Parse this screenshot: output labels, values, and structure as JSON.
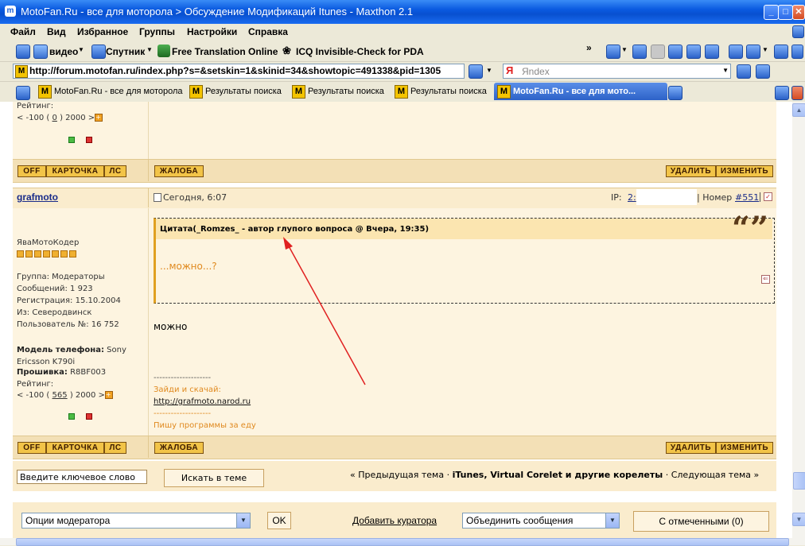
{
  "window": {
    "title": "MotoFan.Ru - все для моторола > Обсуждение Модификаций Itunes - Maxthon 2.1"
  },
  "menu": [
    "Файл",
    "Вид",
    "Избранное",
    "Группы",
    "Настройки",
    "Справка"
  ],
  "toolbar": {
    "video": "видео",
    "sputnik": "Спутник",
    "translate": "Free Translation Online",
    "icq": "ICQ Invisible-Check for PDA"
  },
  "address": {
    "url": "http://forum.motofan.ru/index.php?s=&setskin=1&skinid=34&showtopic=491338&pid=1305",
    "search_placeholder": "Яndex"
  },
  "tabs": [
    {
      "label": "MotoFan.Ru - все для моторола"
    },
    {
      "label": "Результаты поиска"
    },
    {
      "label": "Результаты поиска"
    },
    {
      "label": "Результаты поиска"
    },
    {
      "label": "MotoFan.Ru - все для мото..."
    }
  ],
  "prev_post": {
    "rating_label": "Рейтинг:",
    "rating_range": "< -100 (",
    "rating_value": "0",
    "rating_max": ") 2000 >"
  },
  "buttons": {
    "off": "OFF",
    "card": "КАРТОЧКА",
    "pm": "ЛС",
    "report": "ЖАЛОБА",
    "delete": "УДАЛИТЬ",
    "edit": "ИЗМЕНИТЬ"
  },
  "post": {
    "author": "grafmoto",
    "date": "Сегодня, 6:07",
    "ip_label": "IP:",
    "ip_value": "2:",
    "number_label": "| Номер",
    "number_value": "#551",
    "quote_header": "Цитата(_Romzes_ - автор глупого вопроса @ Вчера, 19:35)",
    "quote_text": "...можно...?",
    "body": "можно",
    "sig_separator": "--------------------",
    "sig_line1": "Зайди и скачай:",
    "sig_link": "http://grafmoto.narod.ru",
    "sig_line2": "Пишу программы за еду"
  },
  "profile": {
    "title": "ЯваМотоКодер",
    "group": "Группа: Модераторы",
    "posts": "Сообщений: 1 923",
    "registered": "Регистрация: 15.10.2004",
    "from": "Из: Северодвинск",
    "user_no": "Пользователь №: 16 752",
    "phone_label": "Модель телефона:",
    "phone_value": "Sony Ericsson K790i",
    "firmware_label": "Прошивка:",
    "firmware_value": "R8BF003",
    "rating_label": "Рейтинг:",
    "rating_range": "< -100 (",
    "rating_value": "565",
    "rating_max": ") 2000 >"
  },
  "search": {
    "placeholder": "Введите ключевое слово",
    "button": "Искать в теме"
  },
  "topic_nav": {
    "prev": "« Предыдущая тема",
    "sep": "·",
    "current": "iTunes, Virtual Corelet и другие корелеты",
    "next": "Следующая тема »"
  },
  "moderation": {
    "options": "Опции модератора",
    "ok": "OK",
    "add_curator": "Добавить куратора",
    "merge": "Объединить сообщения",
    "selected": "С отмеченными (0)"
  },
  "colors": {
    "accent_orange": "#e08a20",
    "link_blue": "#1a2c8a",
    "arrow_red": "#e02020"
  }
}
